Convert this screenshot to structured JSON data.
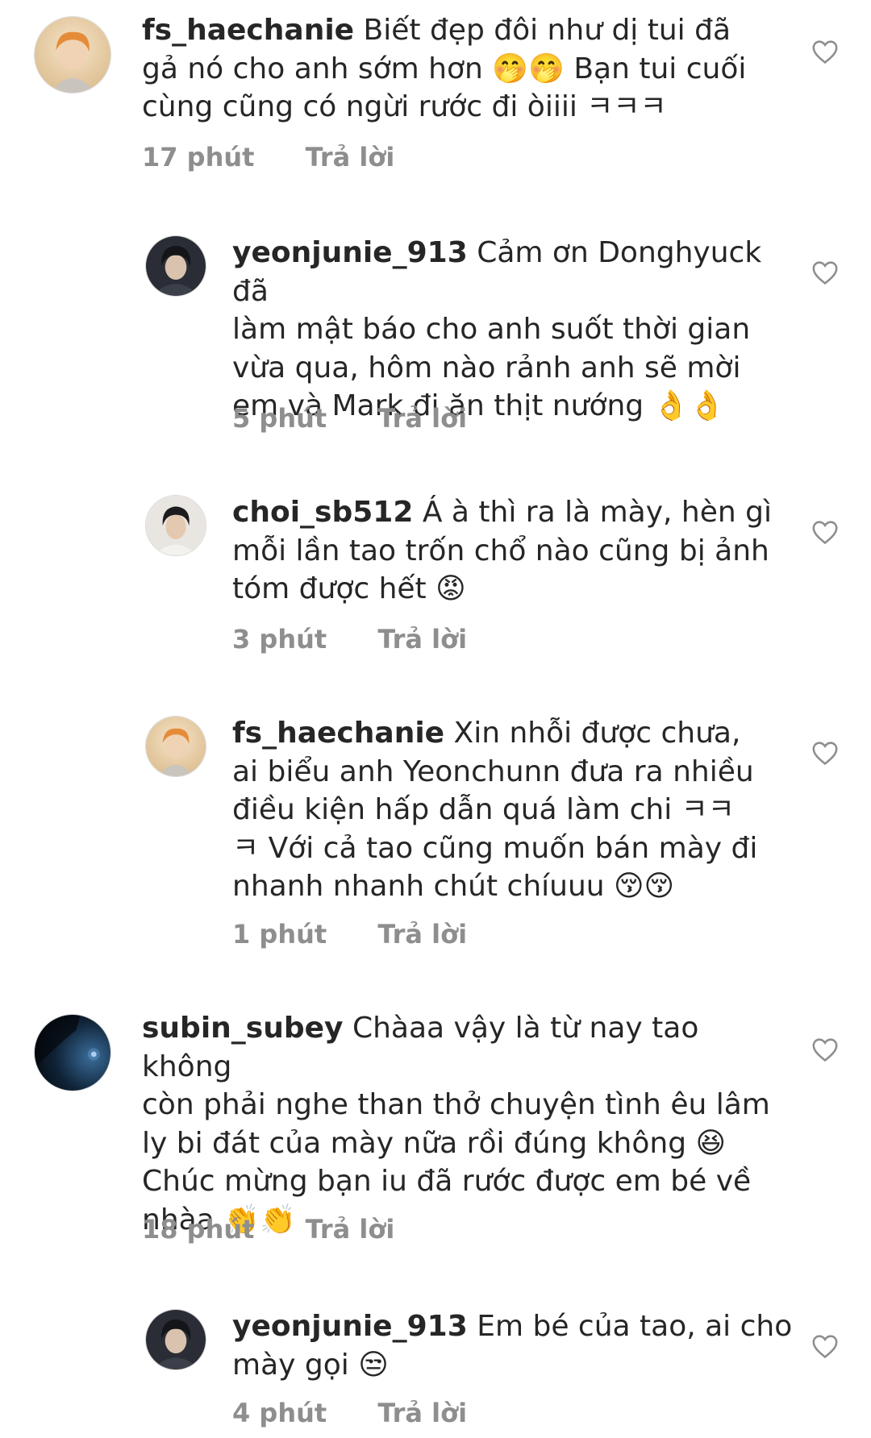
{
  "comments": [
    {
      "username": "fs_haechanie",
      "lines": [
        "Biết đẹp đôi như dị tui đã",
        "gả nó cho anh sớm hơn 🤭🤭 Bạn tui cuối",
        "cùng cũng có ngừi rước đi òiiii ㅋㅋㅋ"
      ],
      "time": "17 phút",
      "reply_label": "Trả lời",
      "avatar_icon": "avatar-orange-hair-icon",
      "type": "top"
    },
    {
      "username": "yeonjunie_913",
      "lines": [
        "Cảm ơn Donghyuck đã",
        "làm mật báo cho anh suốt thời gian",
        "vừa qua, hôm nào rảnh anh sẽ mời",
        "em và Mark đi ăn thịt nướng 👌👌"
      ],
      "time": "5 phút",
      "reply_label": "Trả lời",
      "avatar_icon": "avatar-dark-hair-icon",
      "type": "reply"
    },
    {
      "username": "choi_sb512",
      "lines": [
        "Á à thì ra là mày, hèn gì",
        "mỗi lần tao trốn chổ nào cũng bị ảnh",
        "tóm được hết 😡"
      ],
      "time": "3 phút",
      "reply_label": "Trả lời",
      "avatar_icon": "avatar-dark-hair-light-icon",
      "type": "reply"
    },
    {
      "username": "fs_haechanie",
      "lines": [
        "Xin nhỗi được chưa,",
        "ai biểu anh Yeonchunn đưa ra nhiều",
        "điều kiện hấp dẫn quá làm chi ㅋㅋ",
        "ㅋ Với cả tao cũng muốn bán mày đi",
        "nhanh nhanh chút chíuuu 😚😚"
      ],
      "time": "1 phút",
      "reply_label": "Trả lời",
      "avatar_icon": "avatar-orange-hair-icon",
      "type": "reply"
    },
    {
      "username": "subin_subey",
      "lines": [
        "Chàaa vậy là từ nay tao không",
        "còn phải nghe than thở chuyện tình êu lâm",
        "ly bi đát của mày nữa rồi đúng không 😆",
        "Chúc mừng bạn iu đã rước được em bé về",
        "nhàa 👏👏"
      ],
      "time": "18 phút",
      "reply_label": "Trả lời",
      "avatar_icon": "avatar-night-sky-icon",
      "type": "top"
    },
    {
      "username": "yeonjunie_913",
      "lines": [
        "Em bé của tao, ai cho",
        "mày gọi 😒"
      ],
      "time": "4 phút",
      "reply_label": "Trả lời",
      "avatar_icon": "avatar-dark-hair-icon",
      "type": "reply"
    }
  ],
  "colors": {
    "text": "#262626",
    "meta": "#8e8e8e",
    "heart_stroke": "#8e8e8e",
    "background": "#ffffff"
  }
}
